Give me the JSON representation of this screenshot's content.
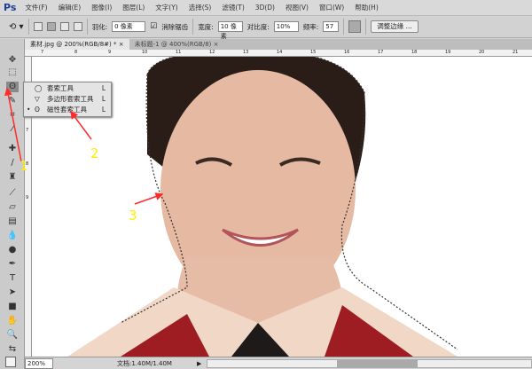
{
  "app": {
    "logo": "Ps"
  },
  "menu": [
    "文件(F)",
    "编辑(E)",
    "图像(I)",
    "图层(L)",
    "文字(Y)",
    "选择(S)",
    "滤镜(T)",
    "3D(D)",
    "视图(V)",
    "窗口(W)",
    "帮助(H)"
  ],
  "options": {
    "feather_label": "羽化:",
    "feather_value": "0 像素",
    "antialias_label": "消除锯齿",
    "antialias_checked": true,
    "width_label": "宽度:",
    "width_value": "10 像素",
    "contrast_label": "对比度:",
    "contrast_value": "10%",
    "frequency_label": "频率:",
    "frequency_value": "57",
    "refine_edge": "调整边缘 ..."
  },
  "tabs": [
    {
      "label": "素材.jpg @ 200%(RGB/8#) *",
      "close": "×",
      "active": true
    },
    {
      "label": "未标题-1 @ 400%(RGB/8)",
      "close": "×",
      "active": false
    }
  ],
  "ruler": {
    "h": [
      "7",
      "8",
      "9",
      "10",
      "11",
      "12",
      "13",
      "14",
      "15",
      "16",
      "17",
      "18",
      "19",
      "20",
      "21"
    ],
    "v": [
      "7",
      "8",
      "9"
    ]
  },
  "flyout": {
    "items": [
      {
        "label": "套索工具",
        "key": "L",
        "selected": false
      },
      {
        "label": "多边形套索工具",
        "key": "L",
        "selected": false
      },
      {
        "label": "磁性套索工具",
        "key": "L",
        "selected": true
      }
    ],
    "bullet": "•"
  },
  "annotations": {
    "one": "1",
    "two": "2",
    "three": "3",
    "arrow_color": "#ff2a2a",
    "label_color": "#ffee00"
  },
  "status": {
    "zoom": "200%",
    "doc": "文档:1.40M/1.40M"
  }
}
